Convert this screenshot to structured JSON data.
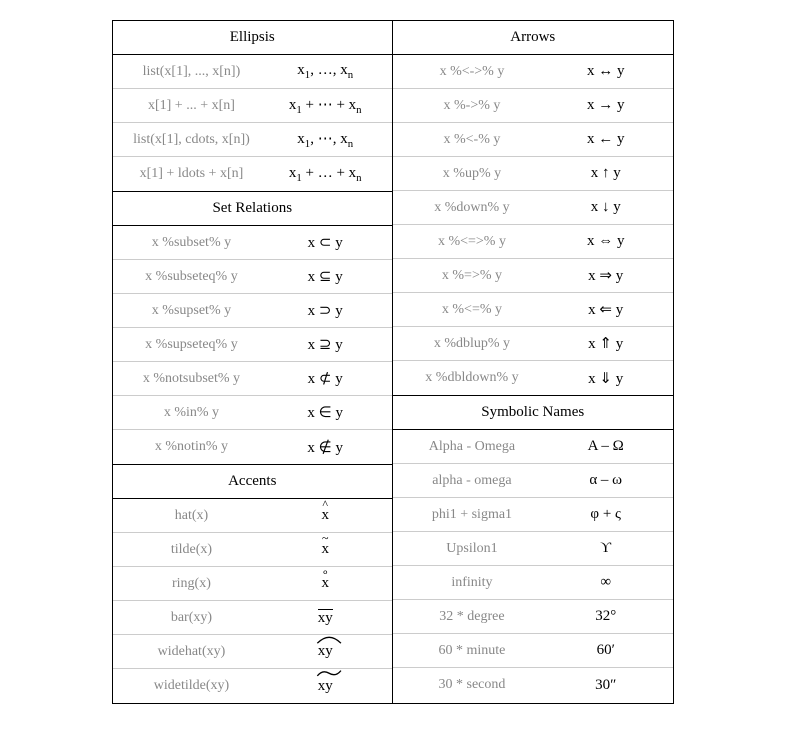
{
  "left": {
    "ellipsis": {
      "title": "Ellipsis",
      "rows": [
        {
          "syntax": "list(x[1], ..., x[n])",
          "result": "x<sub>1</sub>, …, x<sub>n</sub>"
        },
        {
          "syntax": "x[1] + ... + x[n]",
          "result": "x<sub>1</sub> + ⋯ + x<sub>n</sub>"
        },
        {
          "syntax": "list(x[1], cdots, x[n])",
          "result": "x<sub>1</sub>, ⋯, x<sub>n</sub>"
        },
        {
          "syntax": "x[1] + ldots + x[n]",
          "result": "x<sub>1</sub> + … + x<sub>n</sub>"
        }
      ]
    },
    "setrel": {
      "title": "Set Relations",
      "rows": [
        {
          "syntax": "x %subset% y",
          "result": "x ⊂ y"
        },
        {
          "syntax": "x %subseteq% y",
          "result": "x ⊆ y"
        },
        {
          "syntax": "x %supset% y",
          "result": "x ⊃ y"
        },
        {
          "syntax": "x %supseteq% y",
          "result": "x ⊇ y"
        },
        {
          "syntax": "x %notsubset% y",
          "result": "x ⊄ y"
        },
        {
          "syntax": "x %in% y",
          "result": "x ∈ y"
        },
        {
          "syntax": "x %notin% y",
          "result": "x ∉ y"
        }
      ]
    },
    "accents": {
      "title": "Accents",
      "rows": [
        {
          "syntax": "hat(x)",
          "kind": "acc",
          "base": "x",
          "mark": "^"
        },
        {
          "syntax": "tilde(x)",
          "kind": "acc",
          "base": "x",
          "mark": "~"
        },
        {
          "syntax": "ring(x)",
          "kind": "acc",
          "base": "x",
          "mark": "∘"
        },
        {
          "syntax": "bar(xy)",
          "kind": "bar",
          "base": "xy"
        },
        {
          "syntax": "widehat(xy)",
          "kind": "widehat",
          "base": "xy"
        },
        {
          "syntax": "widetilde(xy)",
          "kind": "widetilde",
          "base": "xy"
        }
      ]
    }
  },
  "right": {
    "arrows": {
      "title": "Arrows",
      "rows": [
        {
          "syntax": "x %<->% y",
          "result": "x ↔ y"
        },
        {
          "syntax": "x %->% y",
          "result": "x → y"
        },
        {
          "syntax": "x %<-% y",
          "result": "x ← y"
        },
        {
          "syntax": "x %up% y",
          "result": "x ↑ y"
        },
        {
          "syntax": "x %down% y",
          "result": "x ↓ y"
        },
        {
          "syntax": "x %<=>% y",
          "result": "x ⇔ y"
        },
        {
          "syntax": "x %=>% y",
          "result": "x ⇒ y"
        },
        {
          "syntax": "x %<=% y",
          "result": "x ⇐ y"
        },
        {
          "syntax": "x %dblup% y",
          "result": "x ⇑ y"
        },
        {
          "syntax": "x %dbldown% y",
          "result": "x ⇓ y"
        }
      ]
    },
    "symnames": {
      "title": "Symbolic Names",
      "rows": [
        {
          "syntax": "Alpha - Omega",
          "result": "Α – Ω"
        },
        {
          "syntax": "alpha - omega",
          "result": "α – ω"
        },
        {
          "syntax": "phi1 + sigma1",
          "result": "φ + ς"
        },
        {
          "syntax": "Upsilon1",
          "result": "ϒ"
        },
        {
          "syntax": "infinity",
          "result": "∞"
        },
        {
          "syntax": "32 * degree",
          "result": "32°"
        },
        {
          "syntax": "60 * minute",
          "result": "60′"
        },
        {
          "syntax": "30 * second",
          "result": "30″"
        }
      ]
    }
  }
}
